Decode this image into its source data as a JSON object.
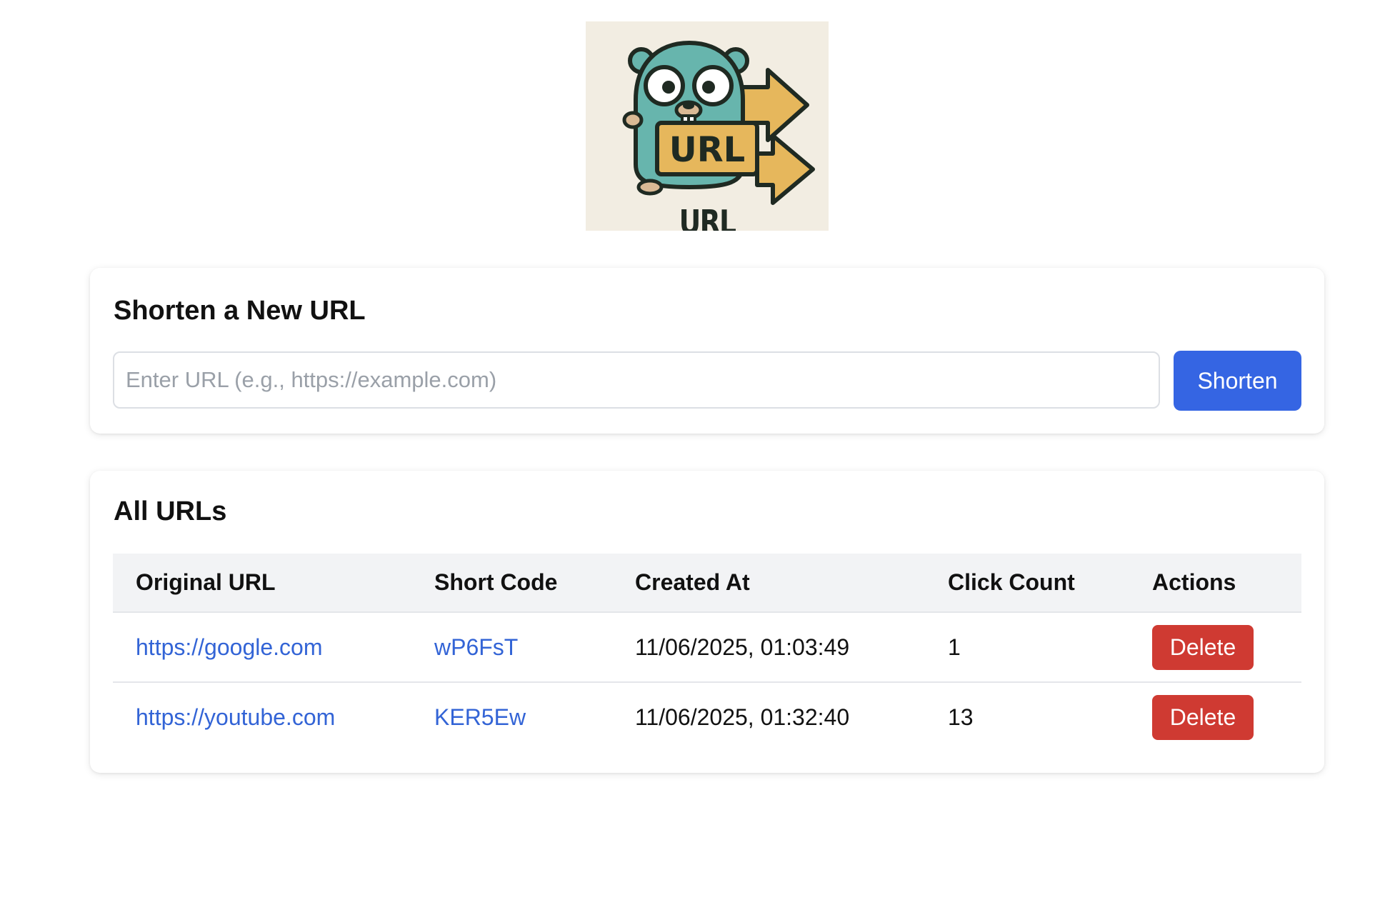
{
  "logo": {
    "text": "URL SHORTENER",
    "badge_text": "URL",
    "colors": {
      "background": "#f2ede2",
      "gopher": "#67b5ad",
      "arrows": "#e6b75c",
      "outline": "#1f2a22"
    }
  },
  "new_url": {
    "title": "Shorten a New URL",
    "placeholder": "Enter URL (e.g., https://example.com)",
    "value": "",
    "button_label": "Shorten"
  },
  "all_urls": {
    "title": "All URLs",
    "columns": [
      "Original URL",
      "Short Code",
      "Created At",
      "Click Count",
      "Actions"
    ],
    "rows": [
      {
        "original_url": "https://google.com",
        "short_code": "wP6FsT",
        "created_at": "11/06/2025, 01:03:49",
        "click_count": "1",
        "action_label": "Delete"
      },
      {
        "original_url": "https://youtube.com",
        "short_code": "KER5Ew",
        "created_at": "11/06/2025, 01:32:40",
        "click_count": "13",
        "action_label": "Delete"
      }
    ]
  },
  "colors": {
    "primary": "#3565e3",
    "danger": "#cf3a32",
    "link": "#3364d6",
    "header_bg": "#f2f3f5"
  }
}
